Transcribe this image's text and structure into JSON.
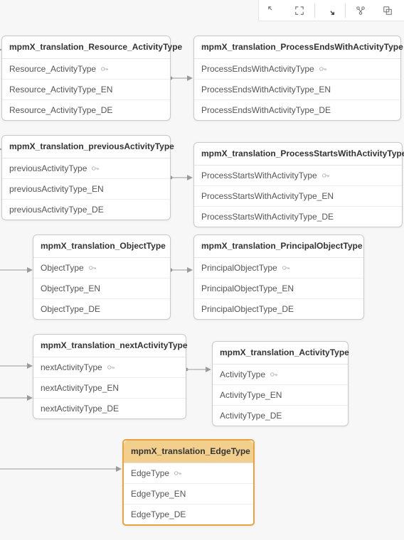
{
  "toolbar": {
    "full_extent_icon": "full-extent-icon",
    "fit_icon": "fit-to-screen-icon",
    "collapse_icon": "collapse-icon",
    "layout_icon": "layout-icon",
    "restore_icon": "restore-icon"
  },
  "tables": {
    "resourceActivity": {
      "title": "mpmX_translation_Resource_ActivityType",
      "pk": "Resource_ActivityType",
      "en": "Resource_ActivityType_EN",
      "de": "Resource_ActivityType_DE"
    },
    "processEnds": {
      "title": "mpmX_translation_ProcessEndsWithActivityType",
      "pk": "ProcessEndsWithActivityType",
      "en": "ProcessEndsWithActivityType_EN",
      "de": "ProcessEndsWithActivityType_DE"
    },
    "previousActivity": {
      "title": "mpmX_translation_previousActivityType",
      "pk": "previousActivityType",
      "en": "previousActivityType_EN",
      "de": "previousActivityType_DE"
    },
    "processStarts": {
      "title": "mpmX_translation_ProcessStartsWithActivityType",
      "pk": "ProcessStartsWithActivityType",
      "en": "ProcessStartsWithActivityType_EN",
      "de": "ProcessStartsWithActivityType_DE"
    },
    "objectType": {
      "title": "mpmX_translation_ObjectType",
      "pk": "ObjectType",
      "en": "ObjectType_EN",
      "de": "ObjectType_DE"
    },
    "principalObject": {
      "title": "mpmX_translation_PrincipalObjectType",
      "pk": "PrincipalObjectType",
      "en": "PrincipalObjectType_EN",
      "de": "PrincipalObjectType_DE"
    },
    "nextActivity": {
      "title": "mpmX_translation_nextActivityType",
      "pk": "nextActivityType",
      "en": "nextActivityType_EN",
      "de": "nextActivityType_DE"
    },
    "activityType": {
      "title": "mpmX_translation_ActivityType",
      "pk": "ActivityType",
      "en": "ActivityType_EN",
      "de": "ActivityType_DE"
    },
    "edgeType": {
      "title": "mpmX_translation_EdgeType",
      "pk": "EdgeType",
      "en": "EdgeType_EN",
      "de": "EdgeType_DE"
    }
  }
}
